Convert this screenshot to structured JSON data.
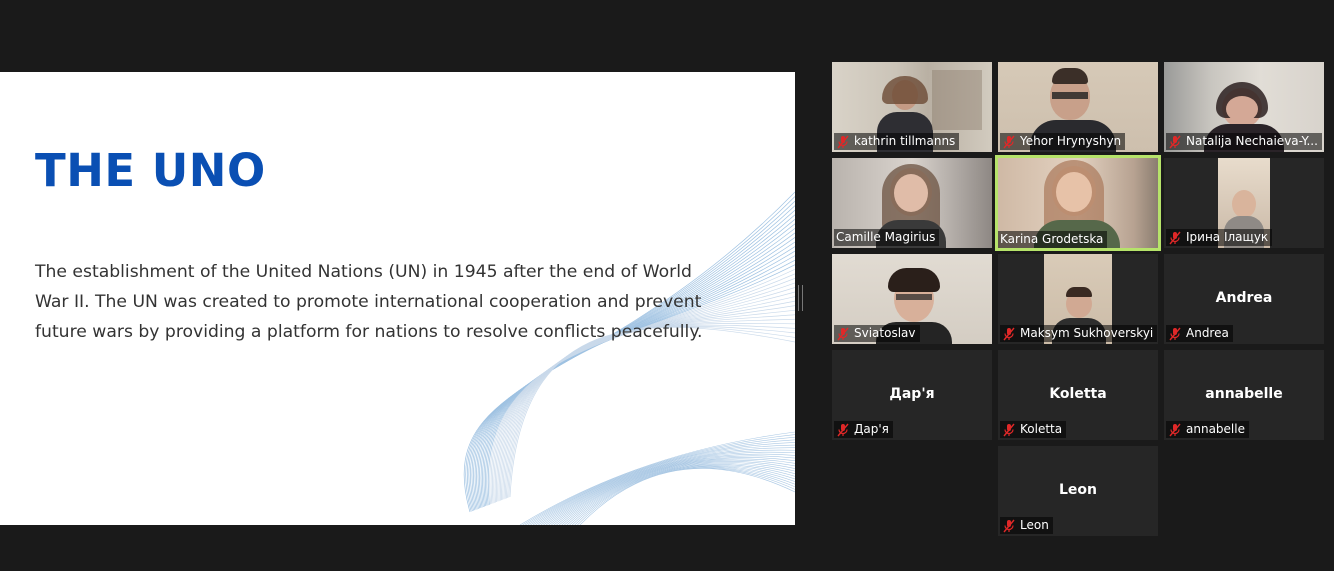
{
  "slide": {
    "title": "THE UNO",
    "body": "The establishment of the United Nations (UN) in 1945 after the end of World War II. The UN was created to promote international cooperation and prevent future wars by providing a platform for nations to resolve conflicts peacefully."
  },
  "participants": [
    {
      "name": "kathrin tillmanns",
      "video": true,
      "muted": true
    },
    {
      "name": "Yehor Hrynyshyn",
      "video": true,
      "muted": true
    },
    {
      "name": "Natalija Nechaieva-Y...",
      "video": true,
      "muted": true
    },
    {
      "name": "Camille Magirius",
      "video": true,
      "muted": false
    },
    {
      "name": "Karina Grodetska",
      "video": true,
      "muted": false,
      "active_speaker": true
    },
    {
      "name": "Ірина Ілащук",
      "video": true,
      "muted": true
    },
    {
      "name": "Sviatoslav",
      "video": true,
      "muted": true
    },
    {
      "name": "Maksym Sukhoverskyi",
      "video": true,
      "muted": true
    },
    {
      "name": "Andrea",
      "display_name": "Andrea",
      "video": false,
      "muted": true
    },
    {
      "name": "Дар'я",
      "display_name": "Дар'я",
      "video": false,
      "muted": true
    },
    {
      "name": "Koletta",
      "display_name": "Koletta",
      "video": false,
      "muted": true
    },
    {
      "name": "annabelle",
      "display_name": "annabelle",
      "video": false,
      "muted": true
    },
    {
      "name": "Leon",
      "display_name": "Leon",
      "video": false,
      "muted": true
    }
  ],
  "colors": {
    "title": "#0a4fb3",
    "active_border": "#b6e36a",
    "muted_icon": "#e02828",
    "background": "#1a1a1a",
    "tile": "#262626"
  },
  "icons": {
    "muted": "microphone-muted-icon"
  }
}
